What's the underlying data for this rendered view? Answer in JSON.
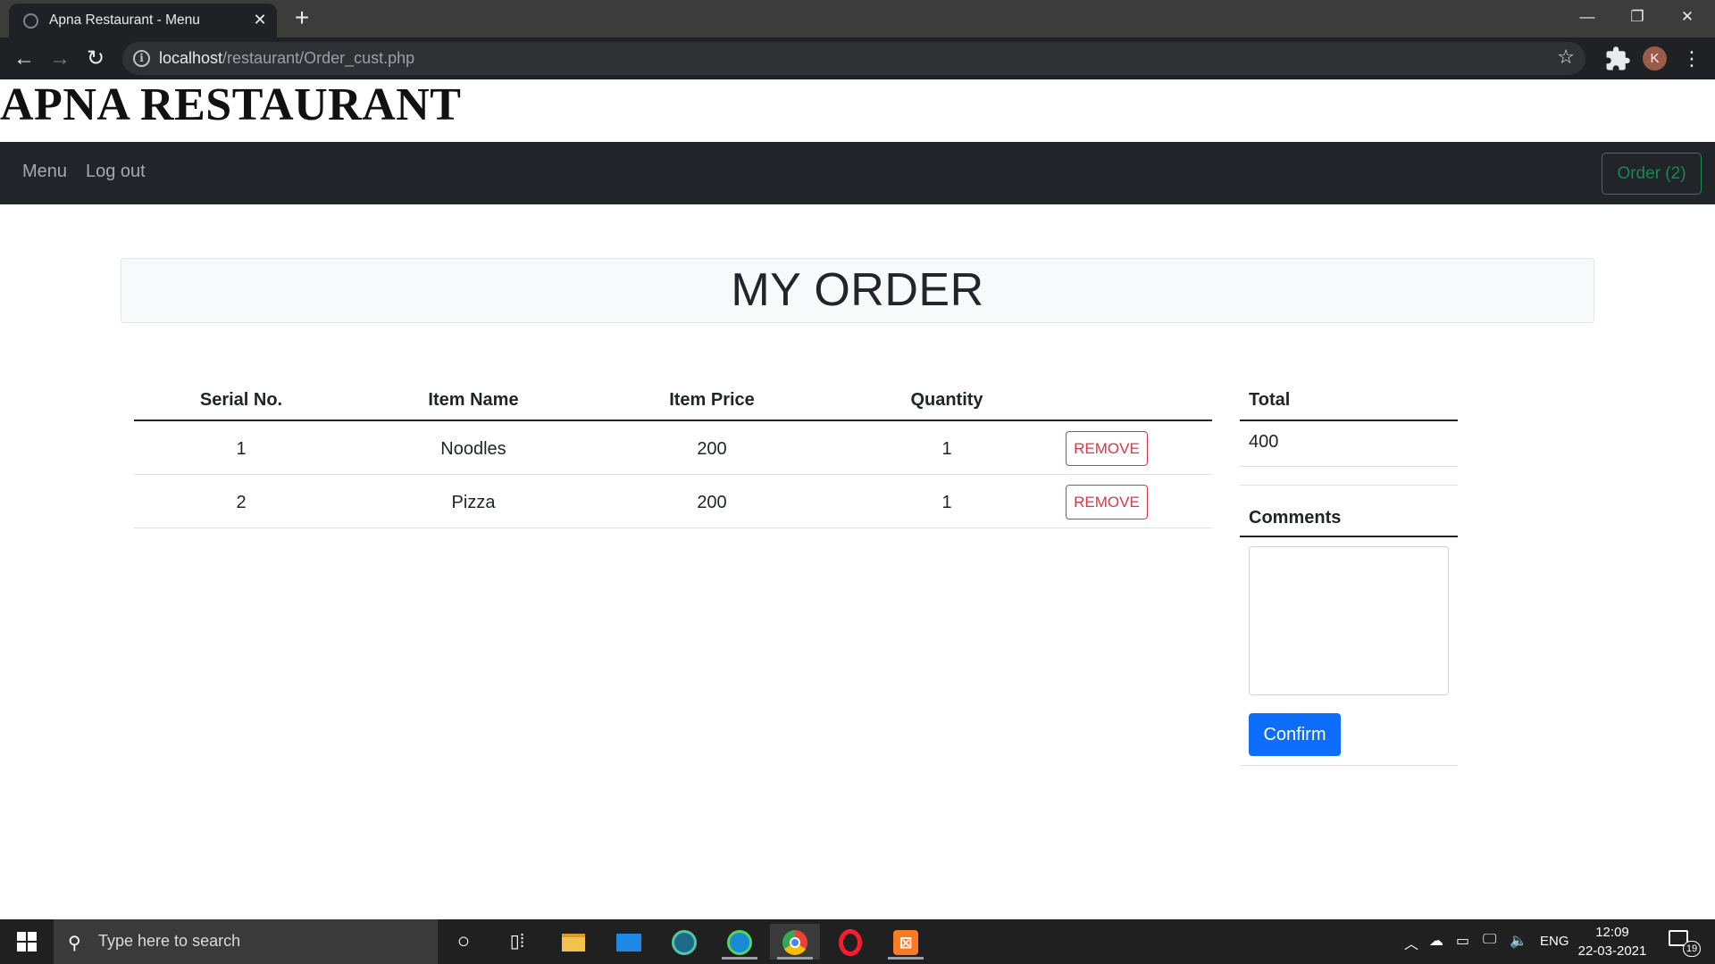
{
  "browser": {
    "tab_title": "Apna Restaurant - Menu",
    "url_host": "localhost",
    "url_path": "/restaurant/Order_cust.php",
    "profile_initial": "K"
  },
  "site": {
    "title": "APNA RESTAURANT",
    "nav": {
      "menu": "Menu",
      "logout": "Log out",
      "order_button": "Order (2)"
    },
    "accent_colors": {
      "order_button": "#198754",
      "remove_button": "#dc3545",
      "confirm_button": "#0d6efd",
      "navbar": "#212529"
    }
  },
  "order": {
    "heading": "MY ORDER",
    "columns": [
      "Serial No.",
      "Item Name",
      "Item Price",
      "Quantity"
    ],
    "rows": [
      {
        "serial": "1",
        "name": "Noodles",
        "price": "200",
        "quantity": "1",
        "action": "REMOVE"
      },
      {
        "serial": "2",
        "name": "Pizza",
        "price": "200",
        "quantity": "1",
        "action": "REMOVE"
      }
    ]
  },
  "summary": {
    "total_label": "Total",
    "total_value": "400",
    "comments_label": "Comments",
    "comments_value": "",
    "confirm_label": "Confirm"
  },
  "taskbar": {
    "search_placeholder": "Type here to search",
    "language": "ENG",
    "time": "12:09",
    "date": "22-03-2021",
    "notification_count": "19",
    "apps": [
      "cortana-icon",
      "task-view-icon",
      "file-explorer-icon",
      "mail-icon",
      "edge-dev-icon",
      "edge-icon",
      "chrome-icon",
      "opera-icon",
      "xampp-icon"
    ]
  }
}
